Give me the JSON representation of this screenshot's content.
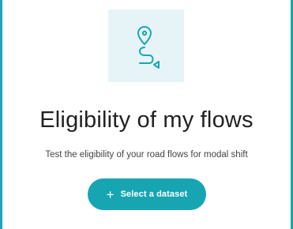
{
  "colors": {
    "accent": "#1aa6b5",
    "illustration_bg": "#e6f4f7",
    "button": "#18a5b2"
  },
  "illustration": {
    "icon": "route-pin-arrow-icon"
  },
  "title": "Eligibility of my flows",
  "subtitle": "Test the eligibility of your road flows for modal shift",
  "select_button": {
    "icon": "plus-icon",
    "plus": "+",
    "label": "Select a dataset"
  }
}
